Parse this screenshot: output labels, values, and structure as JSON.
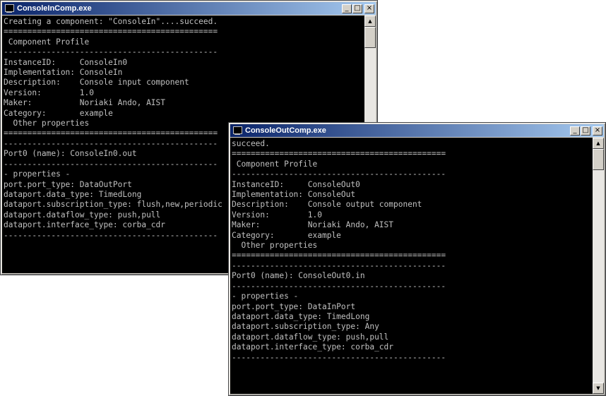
{
  "window_in": {
    "title": "ConsoleInComp.exe",
    "buttons": {
      "minimize": "_",
      "maximize": "□",
      "close": "×"
    },
    "lines": [
      "Creating a component: \"ConsoleIn\"....succeed.",
      "=============================================",
      " Component Profile",
      "---------------------------------------------",
      "InstanceID:     ConsoleIn0",
      "Implementation: ConsoleIn",
      "Description:    Console input component",
      "Version:        1.0",
      "Maker:          Noriaki Ando, AIST",
      "Category:       example",
      "  Other properties",
      "=============================================",
      "---------------------------------------------",
      "Port0 (name): ConsoleIn0.out",
      "---------------------------------------------",
      "- properties -",
      "port.port_type: DataOutPort",
      "dataport.data_type: TimedLong",
      "dataport.subscription_type: flush,new,periodic",
      "dataport.dataflow_type: push,pull",
      "dataport.interface_type: corba_cdr",
      "---------------------------------------------"
    ]
  },
  "window_out": {
    "title": "ConsoleOutComp.exe",
    "buttons": {
      "minimize": "_",
      "maximize": "□",
      "close": "×"
    },
    "lines": [
      "succeed.",
      "=============================================",
      " Component Profile",
      "---------------------------------------------",
      "InstanceID:     ConsoleOut0",
      "Implementation: ConsoleOut",
      "Description:    Console output component",
      "Version:        1.0",
      "Maker:          Noriaki Ando, AIST",
      "Category:       example",
      "  Other properties",
      "=============================================",
      "---------------------------------------------",
      "Port0 (name): ConsoleOut0.in",
      "---------------------------------------------",
      "- properties -",
      "port.port_type: DataInPort",
      "dataport.data_type: TimedLong",
      "dataport.subscription_type: Any",
      "dataport.dataflow_type: push,pull",
      "dataport.interface_type: corba_cdr",
      "---------------------------------------------"
    ]
  },
  "colors": {
    "titlebar_start": "#0a246a",
    "titlebar_end": "#a6caf0",
    "console_bg": "#000000",
    "console_text": "#c0c0c0"
  },
  "icons": {
    "title_icon": "console-window-icon",
    "scroll_up": "arrow-up-icon",
    "scroll_down": "arrow-down-icon"
  }
}
